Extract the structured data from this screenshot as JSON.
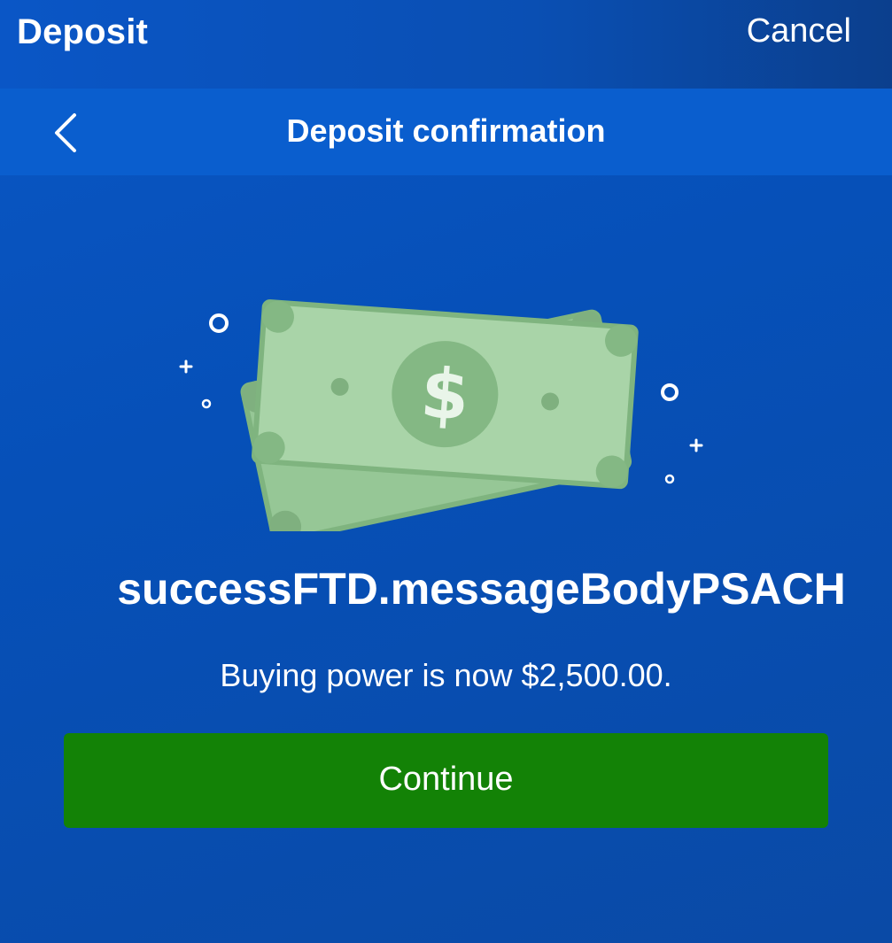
{
  "header": {
    "title": "Deposit",
    "cancel_label": "Cancel"
  },
  "subheader": {
    "title": "Deposit confirmation",
    "back_icon": "chevron-left-icon"
  },
  "illustration": {
    "icon": "money-bills-icon",
    "symbol": "$",
    "colors": {
      "bill": "#a9d4a8",
      "bill_border": "#7fb47f",
      "coin": "#7fb07f"
    }
  },
  "main": {
    "message": "successFTD.messageBodyPSACH",
    "buying_power_text": "Buying power is now $2,500.00."
  },
  "actions": {
    "continue_label": "Continue"
  },
  "colors": {
    "background": "#0650b8",
    "subheader": "#0a5ece",
    "continue_button": "#138206",
    "text": "#ffffff"
  }
}
